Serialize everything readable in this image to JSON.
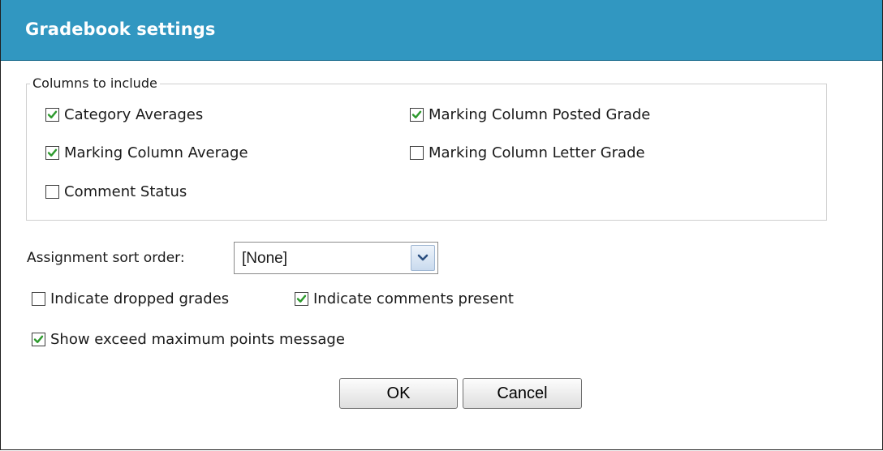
{
  "dialog": {
    "title": "Gradebook settings"
  },
  "columns": {
    "legend": "Columns to include",
    "options": [
      {
        "label": "Category Averages",
        "checked": true
      },
      {
        "label": "Marking Column Posted Grade",
        "checked": true
      },
      {
        "label": "Marking Column Average",
        "checked": true
      },
      {
        "label": "Marking Column Letter Grade",
        "checked": false
      },
      {
        "label": "Comment Status",
        "checked": false
      }
    ]
  },
  "sort": {
    "label": "Assignment sort order:",
    "selected": "[None]"
  },
  "indicators": [
    {
      "label": "Indicate dropped grades",
      "checked": false
    },
    {
      "label": "Indicate comments present",
      "checked": true
    },
    {
      "label": "Show exceed maximum points message",
      "checked": true
    }
  ],
  "buttons": {
    "ok": "OK",
    "cancel": "Cancel"
  },
  "colors": {
    "titlebar": "#3197c1",
    "check": "#2e9a2e"
  }
}
